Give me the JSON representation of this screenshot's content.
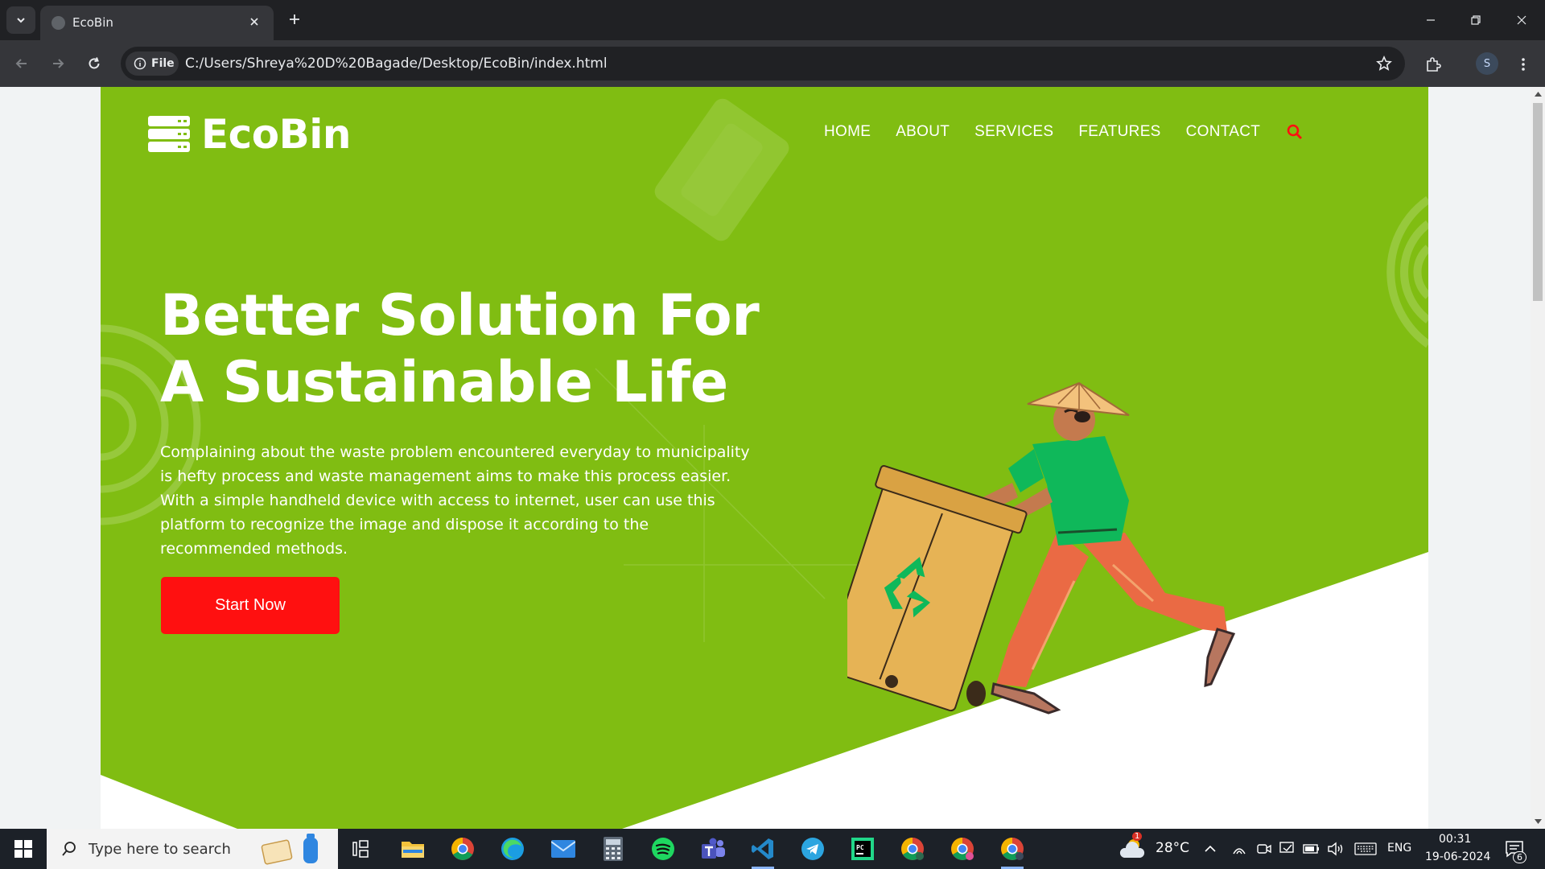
{
  "browser": {
    "tab_title": "EcoBin",
    "url": "C:/Users/Shreya%20D%20Bagade/Desktop/EcoBin/index.html",
    "security_chip": "File",
    "profile_initial": "S"
  },
  "site": {
    "logo_text": "EcoBin",
    "nav": [
      "HOME",
      "ABOUT",
      "SERVICES",
      "FEATURES",
      "CONTACT"
    ],
    "headline_line1": "Better Solution For",
    "headline_line2": "A Sustainable Life",
    "description": "Complaining about the waste problem encountered everyday to municipality is hefty process and waste management aims to make this process easier. With a simple handheld device with access to internet, user can use this platform to recognize the image and dispose it according to the recommended methods.",
    "cta_label": "Start Now",
    "colors": {
      "hero_green": "#80bd12",
      "accent_red": "#ff1010"
    }
  },
  "taskbar": {
    "search_placeholder": "Type here to search",
    "weather": "28°C",
    "weather_badge": "1",
    "language": "ENG",
    "time": "00:31",
    "date": "19-06-2024",
    "notification_count": "6"
  }
}
